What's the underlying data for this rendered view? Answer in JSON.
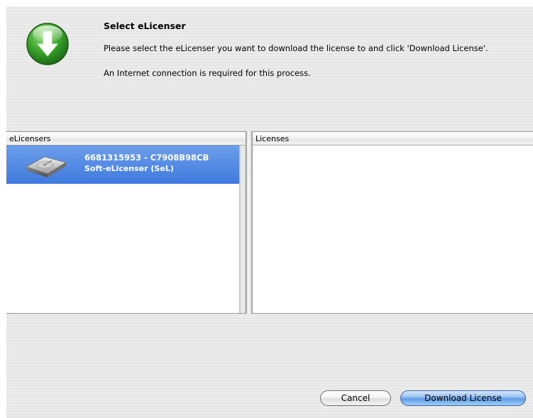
{
  "dialog": {
    "title": "Select eLicenser",
    "description": "Please select the eLicenser you want to download the license to and click 'Download License'.",
    "note": "An Internet connection is required for this process.",
    "icon": "download-arrow-icon",
    "accent_color": "#3b9c2c"
  },
  "elicensers_pane": {
    "header": "eLicensers",
    "items": [
      {
        "id_text": "6681315953 - C7908B98CB",
        "type_text": "Soft-eLicenser (SeL)",
        "icon": "hard-drive-icon",
        "selected": true
      }
    ]
  },
  "licenses_pane": {
    "header": "Licenses",
    "items": []
  },
  "buttons": {
    "cancel_label": "Cancel",
    "download_label": "Download License"
  },
  "colors": {
    "selection": "#4a83e2",
    "default_button": "#5f9be6"
  }
}
